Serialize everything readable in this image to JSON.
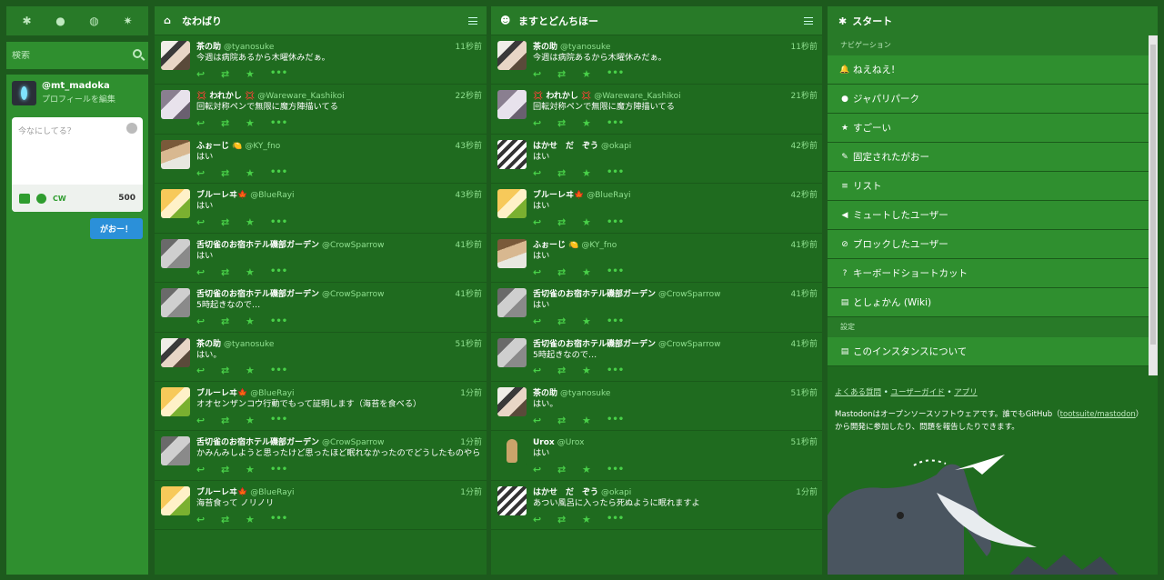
{
  "drawer": {
    "nav_icons": [
      "asterisk-icon",
      "bell-icon",
      "globe-icon",
      "gear-icon"
    ],
    "search_placeholder": "検索",
    "account": {
      "username": "@mt_madoka",
      "edit_label": "プロフィールを編集"
    },
    "compose_placeholder": "今なにしてる？",
    "cw_label": "CW",
    "char_count": "500",
    "submit_label": "がおー！"
  },
  "columns": [
    {
      "title": "なわばり",
      "icon": "home-icon",
      "statuses": [
        {
          "av": "wolf",
          "display_name": "茶の助",
          "username": "@tyanosuke",
          "time": "11秒前",
          "content": "今週は病院あるから木曜休みだぁ。"
        },
        {
          "av": "silver",
          "display_name": "💢 われかし 💢",
          "username": "@Wareware_Kashikoi",
          "time": "22秒前",
          "content": "回転対称ペンで無限に魔方陣描いてる"
        },
        {
          "av": "fox",
          "display_name": "ふぉーじ 🍋",
          "username": "@KY_fno",
          "time": "43秒前",
          "content": "はい"
        },
        {
          "av": "serval",
          "display_name": "ブルーレヰ🍁",
          "username": "@BlueRayi",
          "time": "43秒前",
          "content": "はい"
        },
        {
          "av": "owl",
          "display_name": "舌切雀のお宿ホテル磯部ガーデン",
          "username": "@CrowSparrow",
          "time": "41秒前",
          "content": "はい"
        },
        {
          "av": "owl",
          "display_name": "舌切雀のお宿ホテル磯部ガーデン",
          "username": "@CrowSparrow",
          "time": "41秒前",
          "content": "5時起きなので…"
        },
        {
          "av": "wolf",
          "display_name": "茶の助",
          "username": "@tyanosuke",
          "time": "51秒前",
          "content": "はい。"
        },
        {
          "av": "serval",
          "display_name": "ブルーレヰ🍁",
          "username": "@BlueRayi",
          "time": "1分前",
          "content": "オオセンザンコウ行動でもって証明します（海苔を食べる）"
        },
        {
          "av": "owl",
          "display_name": "舌切雀のお宿ホテル磯部ガーデン",
          "username": "@CrowSparrow",
          "time": "1分前",
          "content": "かみんみしようと思ったけど思ったほど眠れなかったのでどうしたものやら"
        },
        {
          "av": "serval",
          "display_name": "ブルーレヰ🍁",
          "username": "@BlueRayi",
          "time": "1分前",
          "content": "海苔食って ノリノリ"
        }
      ]
    },
    {
      "title": "ますとどんちほー",
      "icon": "users-icon",
      "statuses": [
        {
          "av": "wolf",
          "display_name": "茶の助",
          "username": "@tyanosuke",
          "time": "11秒前",
          "content": "今週は病院あるから木曜休みだぁ。"
        },
        {
          "av": "silver",
          "display_name": "💢 われかし 💢",
          "username": "@Wareware_Kashikoi",
          "time": "21秒前",
          "content": "回転対称ペンで無限に魔方陣描いてる"
        },
        {
          "av": "okapi",
          "display_name": "はかせ　だ　ぞう",
          "username": "@okapi",
          "time": "42秒前",
          "content": "はい"
        },
        {
          "av": "serval",
          "display_name": "ブルーレヰ🍁",
          "username": "@BlueRayi",
          "time": "42秒前",
          "content": "はい"
        },
        {
          "av": "fox",
          "display_name": "ふぉーじ 🍋",
          "username": "@KY_fno",
          "time": "41秒前",
          "content": "はい"
        },
        {
          "av": "owl",
          "display_name": "舌切雀のお宿ホテル磯部ガーデン",
          "username": "@CrowSparrow",
          "time": "41秒前",
          "content": "はい"
        },
        {
          "av": "owl",
          "display_name": "舌切雀のお宿ホテル磯部ガーデン",
          "username": "@CrowSparrow",
          "time": "41秒前",
          "content": "5時起きなので…"
        },
        {
          "av": "wolf",
          "display_name": "茶の助",
          "username": "@tyanosuke",
          "time": "51秒前",
          "content": "はい。"
        },
        {
          "av": "urox",
          "display_name": "Urox",
          "username": "@Urox",
          "time": "51秒前",
          "content": "はい"
        },
        {
          "av": "okapi",
          "display_name": "はかせ　だ　ぞう",
          "username": "@okapi",
          "time": "1分前",
          "content": "あつい風呂に入ったら死ぬように眠れますよ"
        }
      ]
    }
  ],
  "start": {
    "title": "スタート",
    "nav_section": "ナビゲーション",
    "nav_items": [
      {
        "icon": "bell-icon",
        "glyph": "🔔",
        "label": "ねえねえ!"
      },
      {
        "icon": "globe-icon",
        "glyph": "●",
        "label": "ジャパリパーク"
      },
      {
        "icon": "star-icon",
        "glyph": "★",
        "label": "すごーい"
      },
      {
        "icon": "pin-icon",
        "glyph": "✎",
        "label": "固定されたがおー"
      },
      {
        "icon": "list-icon",
        "glyph": "≡",
        "label": "リスト"
      },
      {
        "icon": "mute-icon",
        "glyph": "◀",
        "label": "ミュートしたユーザー"
      },
      {
        "icon": "block-icon",
        "glyph": "⊘",
        "label": "ブロックしたユーザー"
      },
      {
        "icon": "question-icon",
        "glyph": "?",
        "label": "キーボードショートカット"
      },
      {
        "icon": "book-icon",
        "glyph": "▤",
        "label": "としょかん (Wiki)"
      }
    ],
    "settings_section": "設定",
    "settings_items": [
      {
        "icon": "book-icon",
        "glyph": "▤",
        "label": "このインスタンスについて"
      }
    ],
    "links": [
      "よくある質問",
      "ユーザーガイド",
      "アプリ"
    ],
    "about_prefix": "Mastodonはオープンソースソフトウェアです。誰でもGitHub（",
    "about_link": "tootsuite/mastodon",
    "about_suffix": "）から開発に参加したり、問題を報告したりできます。"
  }
}
